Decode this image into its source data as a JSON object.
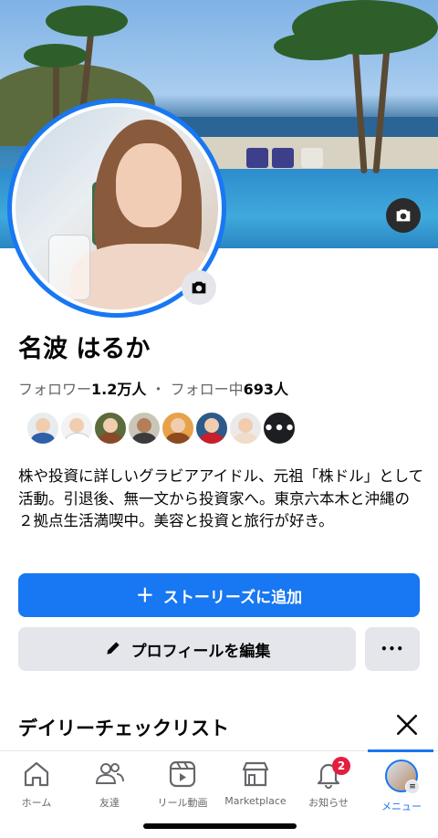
{
  "profile": {
    "name": "名波 はるか",
    "followers_label": "フォロワー",
    "followers_count": "1.2万人",
    "separator": " ・ ",
    "following_label": "フォロー中",
    "following_count": "693人",
    "bio": "株や投資に詳しいグラビアアイドル、元祖「株ドル」として活動。引退後、無一文から投資家へ。東京六本木と沖縄の２拠点生活満喫中。美容と投資と旅行が好き。",
    "friends_more_label": "•••"
  },
  "actions": {
    "add_story": "ストーリーズに追加",
    "edit_profile": "プロフィールを編集",
    "more": "•••"
  },
  "checklist": {
    "title": "デイリーチェックリスト"
  },
  "tabbar": {
    "items": [
      {
        "label": "ホーム",
        "icon": "home-icon"
      },
      {
        "label": "友達",
        "icon": "friends-icon"
      },
      {
        "label": "リール動画",
        "icon": "reels-icon"
      },
      {
        "label": "Marketplace",
        "icon": "marketplace-icon"
      },
      {
        "label": "お知らせ",
        "icon": "bell-icon",
        "badge": "2"
      },
      {
        "label": "メニュー",
        "icon": "menu-avatar-icon",
        "active": true
      }
    ]
  },
  "colors": {
    "accent": "#1877f2",
    "secondary_button": "#e4e6eb",
    "badge": "#e41e3f",
    "muted_text": "#65676b"
  }
}
